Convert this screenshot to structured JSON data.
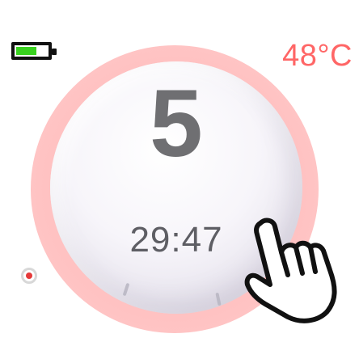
{
  "status": {
    "battery_level": 0.6,
    "temperature": "48°C"
  },
  "knob": {
    "level": "5",
    "timer": "29:47"
  },
  "icons": {
    "battery": "battery-icon",
    "hand": "hand-pointer-icon",
    "radio": "radio-dot-icon"
  },
  "colors": {
    "temperature": "#ff6666",
    "battery_fill": "#39d21f",
    "glow": "#ff9a9a",
    "radio_dot": "#e53a3a"
  }
}
